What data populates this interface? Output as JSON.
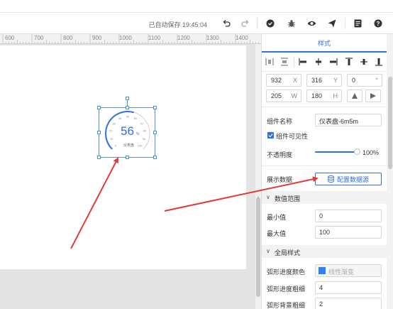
{
  "toolbar": {
    "autosave": "已自动保存 19:45:04",
    "icons": [
      "undo-icon",
      "redo-icon",
      "check-circle-icon",
      "bug-icon",
      "eye-icon",
      "send-icon",
      "document-icon",
      "help-icon"
    ]
  },
  "ruler": {
    "labels": [
      "600",
      "700",
      "800",
      "900",
      "1000",
      "1100",
      "1200",
      "1300",
      "1400"
    ]
  },
  "gauge": {
    "value": "56",
    "unit": "%",
    "label": "仪表盘",
    "progress": 0.56,
    "ticks": [
      "0",
      "10",
      "20",
      "30",
      "40",
      "50",
      "60",
      "70",
      "80",
      "90",
      "100"
    ],
    "colors": {
      "progress": "#2f6fe0",
      "track": "#d0d0d0",
      "arrow": "#e53935"
    }
  },
  "panel": {
    "tab": "样式",
    "position": {
      "x": "932",
      "x_unit": "X",
      "y": "316",
      "y_unit": "Y",
      "rotate": "0",
      "rotate_unit": "°",
      "w": "205",
      "w_unit": "W",
      "h": "180",
      "h_unit": "H"
    },
    "name_label": "组件名称",
    "name_value": "仪表盘-6m5m",
    "visible_label": "组件可见性",
    "opacity_label": "不透明度",
    "opacity_value": "100%",
    "opacity": 1.0,
    "data_label": "展示数据",
    "data_button": "配置数据源",
    "range_section": "数值范围",
    "min_label": "最小值",
    "min_value": "0",
    "max_label": "最大值",
    "max_value": "100",
    "style_section": "全局样式",
    "arc_color_label": "弧形进度颜色",
    "arc_color_value": "线性渐变",
    "arc_width_label": "弧形进度粗细",
    "arc_width_value": "4",
    "arc_bg_label": "弧形背景粗细",
    "arc_bg_value": "2",
    "accent": "#2f6fe0"
  }
}
